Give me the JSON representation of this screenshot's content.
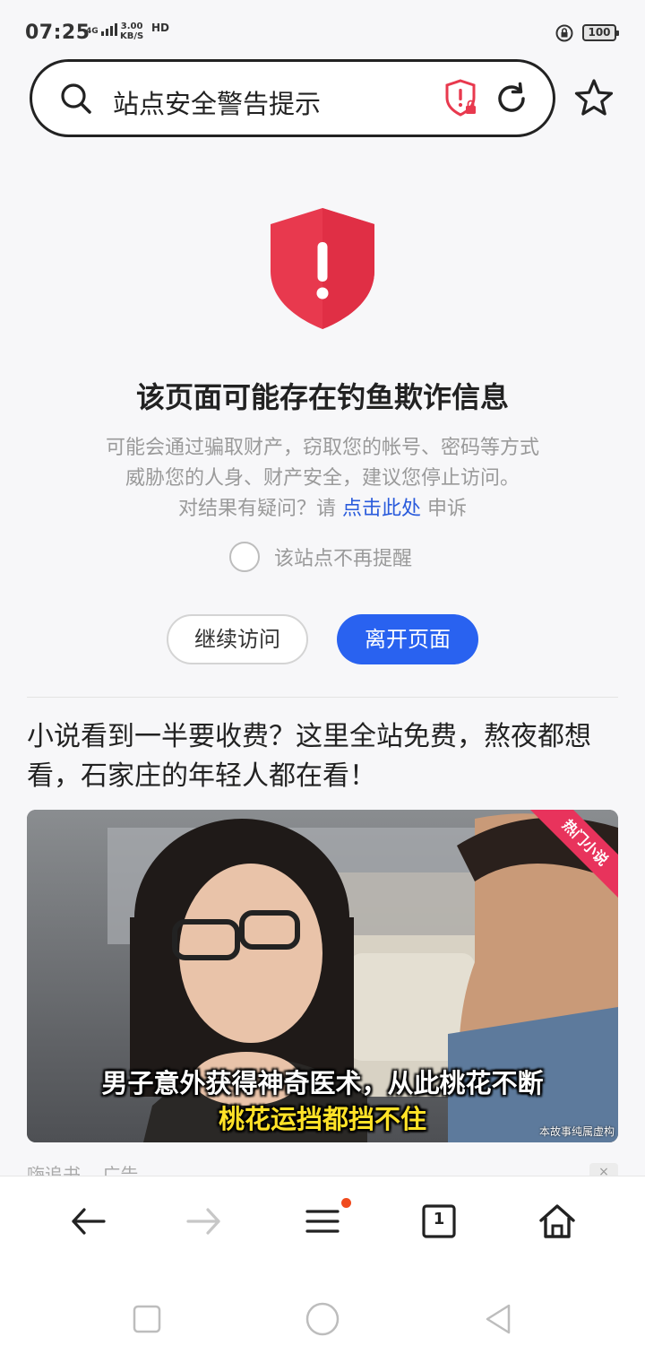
{
  "status_bar": {
    "time": "07:25",
    "network": "4G",
    "speed_value": "3.00",
    "speed_unit": "KB/S",
    "hd": "HD",
    "battery": "100"
  },
  "address_bar": {
    "title": "站点安全警告提示",
    "search_icon": "search-icon",
    "security_icon": "shield-alert-icon",
    "refresh_icon": "refresh-icon",
    "bookmark_icon": "star-icon"
  },
  "warning": {
    "icon": "shield-exclamation-icon",
    "title": "该页面可能存在钓鱼欺诈信息",
    "desc_line1": "可能会通过骗取财产，窃取您的帐号、密码等方式",
    "desc_line2": "威胁您的人身、财产安全，建议您停止访问。",
    "appeal_prefix": "对结果有疑问？请",
    "appeal_link": "点击此处",
    "appeal_suffix": "申诉",
    "no_remind_label": "该站点不再提醒",
    "continue_label": "继续访问",
    "leave_label": "离开页面",
    "accent_color": "#2962f0",
    "shield_color": "#e8394e"
  },
  "ad": {
    "headline": "小说看到一半要收费？这里全站免费，熬夜都想看，石家庄的年轻人都在看！",
    "ribbon": "热门小说",
    "caption_line1": "男子意外获得神奇医术，从此桃花不断",
    "caption_line2": "桃花运挡都挡不住",
    "disclaimer": "本故事纯属虚构",
    "source": "嗨追书",
    "ad_tag": "广告",
    "close": "×"
  },
  "toolbar": {
    "back": "back-arrow-icon",
    "forward": "forward-arrow-icon",
    "menu": "menu-icon",
    "tabs_count": "1",
    "home": "home-icon"
  },
  "navbar": {
    "recent": "square-icon",
    "home": "circle-icon",
    "back": "triangle-back-icon"
  }
}
